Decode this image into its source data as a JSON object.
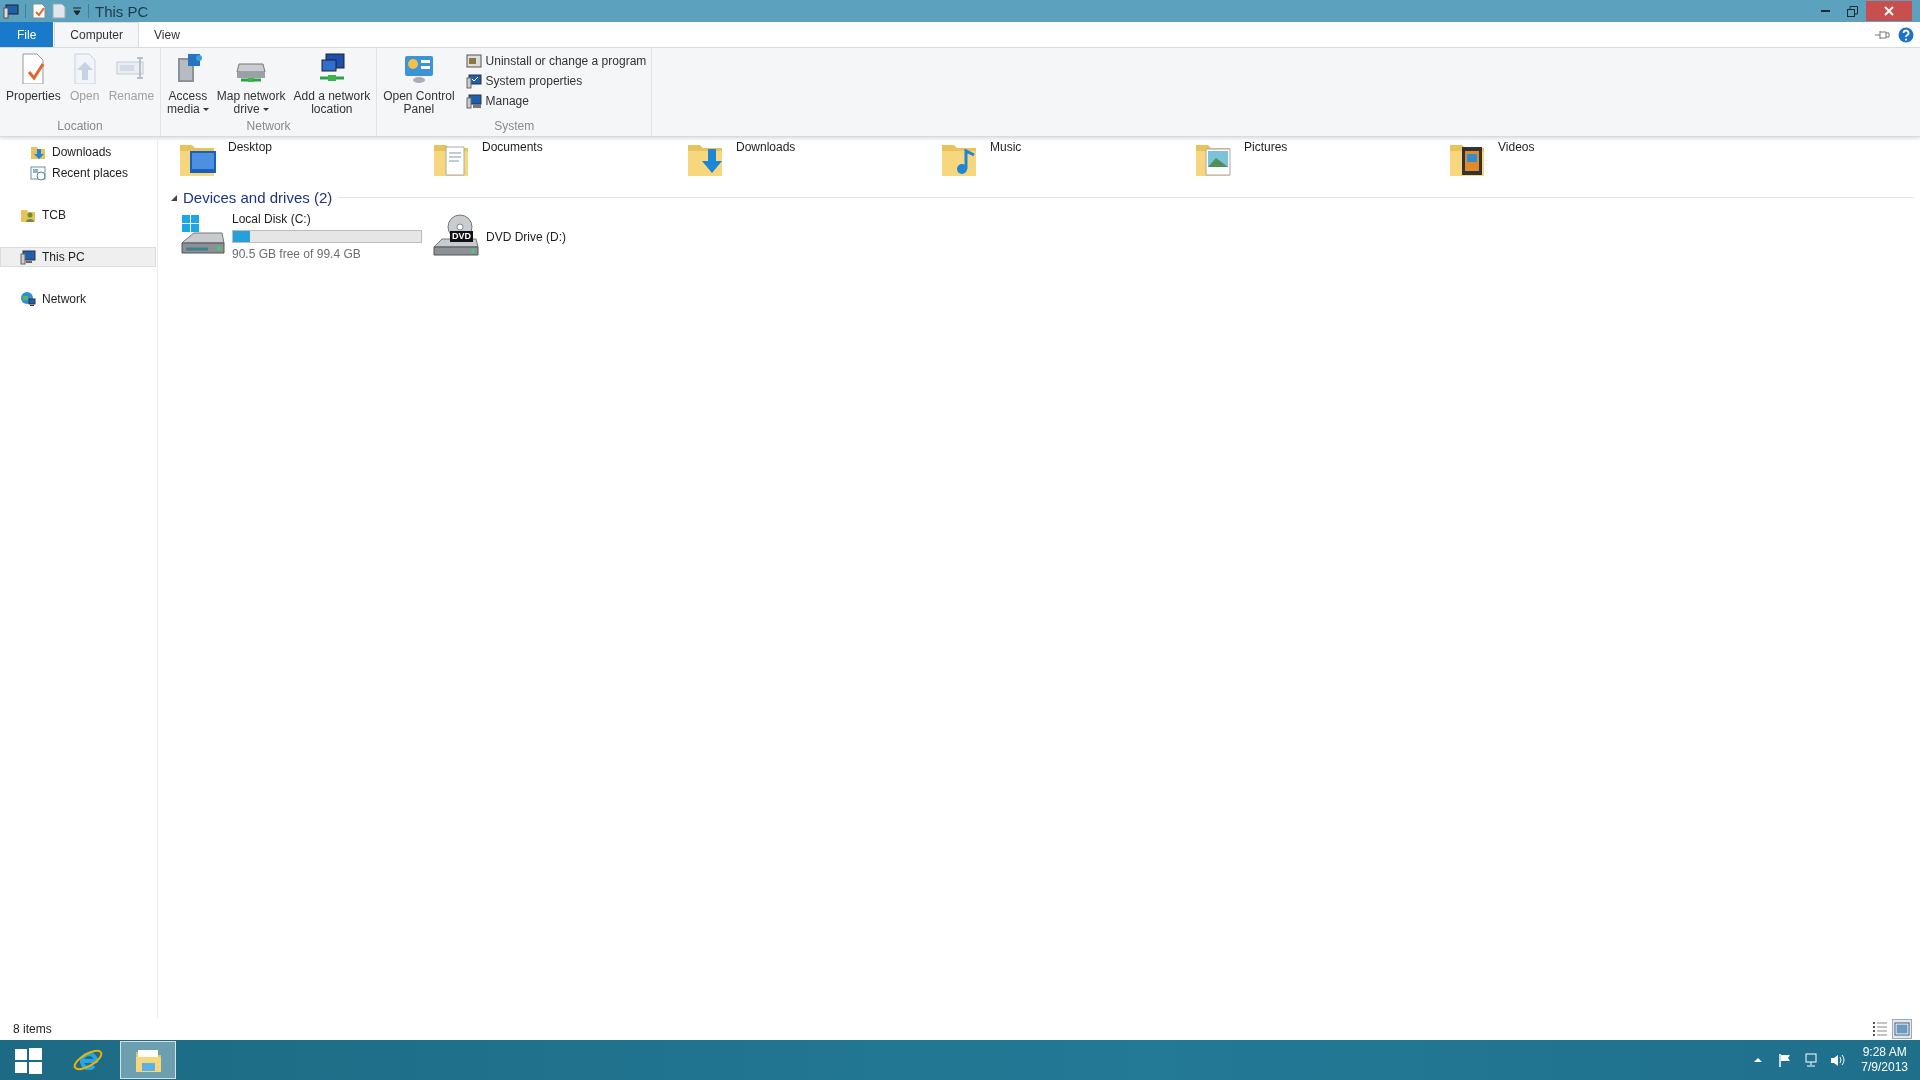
{
  "window": {
    "title": "This PC"
  },
  "ribbon_tabs": [
    {
      "label": "File",
      "kind": "file",
      "selected": false
    },
    {
      "label": "Computer",
      "kind": "tab",
      "selected": true
    },
    {
      "label": "View",
      "kind": "tab",
      "selected": false
    }
  ],
  "ribbon_groups": [
    {
      "label": "Location",
      "commands": [
        {
          "label": "Properties",
          "kind": "properties",
          "disabled": false,
          "dropdown": false
        },
        {
          "label": "Open",
          "kind": "open",
          "disabled": true,
          "dropdown": false
        },
        {
          "label": "Rename",
          "kind": "rename",
          "disabled": true,
          "dropdown": false
        }
      ]
    },
    {
      "label": "Network",
      "commands": [
        {
          "label": "Access\nmedia",
          "kind": "media",
          "disabled": false,
          "dropdown": true
        },
        {
          "label": "Map network\ndrive",
          "kind": "mapdrive",
          "disabled": false,
          "dropdown": true
        },
        {
          "label": "Add a network\nlocation",
          "kind": "netloc",
          "disabled": false,
          "dropdown": false
        }
      ]
    },
    {
      "label": "System",
      "commands": [
        {
          "label": "Open Control\nPanel",
          "kind": "control",
          "disabled": false,
          "dropdown": false
        }
      ],
      "small_commands": [
        {
          "label": "Uninstall or change a program",
          "kind": "uninstall"
        },
        {
          "label": "System properties",
          "kind": "sysprops"
        },
        {
          "label": "Manage",
          "kind": "manage"
        }
      ]
    }
  ],
  "sidebar": {
    "items": [
      {
        "children": [
          {
            "label": "Downloads",
            "kind": "downloads",
            "selected": false
          },
          {
            "label": "Recent places",
            "kind": "recent",
            "selected": false
          }
        ]
      },
      {
        "label": "TCB",
        "kind": "user",
        "selected": false
      },
      {
        "label": "This PC",
        "kind": "pc",
        "selected": true
      },
      {
        "label": "Network",
        "kind": "network",
        "selected": false
      }
    ]
  },
  "folders": [
    {
      "label": "Desktop",
      "kind": "desktop"
    },
    {
      "label": "Documents",
      "kind": "documents"
    },
    {
      "label": "Downloads",
      "kind": "downloads"
    },
    {
      "label": "Music",
      "kind": "music"
    },
    {
      "label": "Pictures",
      "kind": "pictures"
    },
    {
      "label": "Videos",
      "kind": "videos"
    }
  ],
  "devices": {
    "title": "Devices and drives (2)",
    "expanded": true,
    "items": [
      {
        "label": "Local Disk (C:)",
        "kind": "disk",
        "level": 0.09,
        "detail": "90.5 GB free of 99.4 GB"
      },
      {
        "label": "DVD Drive (D:)",
        "kind": "dvd",
        "badge": "DVD"
      }
    ]
  },
  "status_bar": {
    "text": "8 items",
    "view_modes": [
      {
        "kind": "details",
        "selected": false
      },
      {
        "kind": "large",
        "selected": true
      }
    ]
  },
  "taskbar": {
    "apps": [
      {
        "kind": "start",
        "selected": false
      },
      {
        "kind": "browser",
        "selected": false
      },
      {
        "kind": "explorer",
        "selected": true
      }
    ],
    "tray": [
      {
        "kind": "up"
      },
      {
        "kind": "flag"
      },
      {
        "kind": "network"
      },
      {
        "kind": "volume"
      }
    ],
    "time": "9:28 AM",
    "date": "7/9/2013"
  }
}
